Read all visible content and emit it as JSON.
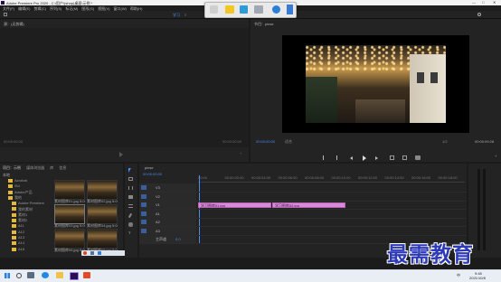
{
  "window": {
    "title": "Adobe Premiere Pro 2020 - C:\\用户\\(shop)桌面\\示例 *",
    "controls": [
      "—",
      "□",
      "✕"
    ]
  },
  "menu": [
    "文件(F)",
    "编辑(E)",
    "剪辑(C)",
    "序列(S)",
    "标记(M)",
    "图形(G)",
    "视图(V)",
    "窗口(W)",
    "帮助(H)"
  ],
  "workspace": {
    "active": "学习",
    "separator": "≡"
  },
  "source": {
    "tab": "源：(无剪辑)",
    "timecode_left": "00:00:00:00",
    "timecode_right": "00:00:00:00"
  },
  "program": {
    "tab": "节目：pinse",
    "timecode_left": "00:00:00:00",
    "fit": "适合",
    "quality": "1/2",
    "timecode_right": "00:00:09:28"
  },
  "project": {
    "tabs": [
      "项目：示例",
      "媒体浏览器",
      "库",
      "信息"
    ],
    "path_label": "本地",
    "folders": [
      "Acrobat",
      "iSd",
      "Adobe产品",
      "我的",
      "Adobe Premiere",
      "我的素材",
      "素材1",
      "素材2",
      "A11",
      "A12",
      "A13",
      "A14",
      "A15"
    ],
    "thumbs": [
      "素材图库01.jpg 5:00",
      "素材图库02.jpg 5:00",
      "素材图库03.jpg 5:00",
      "素材图库04.jpg 5:00",
      "素材图库05.jpg 5:00",
      "素材图库06.jpg 5:00"
    ]
  },
  "timeline": {
    "tab": "pinse",
    "timecode": "00:00:00:00",
    "tracks": [
      {
        "name": "V3",
        "kind": "video"
      },
      {
        "name": "V2",
        "kind": "video"
      },
      {
        "name": "V1",
        "kind": "video"
      },
      {
        "name": "A1",
        "kind": "audio"
      },
      {
        "name": "A2",
        "kind": "audio"
      },
      {
        "name": "A3",
        "kind": "audio"
      },
      {
        "name": "主声道",
        "kind": "master",
        "value": "0.0"
      }
    ],
    "ruler": [
      "00:00",
      "00:00:02:00",
      "00:00:04:00",
      "00:00:06:00",
      "00:00:08:00",
      "00:00:10:00",
      "00:00:12:00",
      "00:00:14:00",
      "00:00:16:00",
      "00:00:18:00"
    ],
    "clips": [
      {
        "label": "学习图库01.jpg",
        "track": "V1",
        "start_s": 0.0,
        "end_s": 5.0
      },
      {
        "label": "学习图库02.jpg",
        "track": "V1",
        "start_s": 5.0,
        "end_s": 10.0
      }
    ],
    "duration_s": 18
  },
  "taskbar": {
    "search": "搜索",
    "time": "9:48",
    "date": "2021/10/8",
    "lang": "中"
  },
  "watermark": "最需教育",
  "colors": {
    "clip": "#d98ad8",
    "accent": "#4a8af4",
    "watermark": "#2f3ab7"
  }
}
